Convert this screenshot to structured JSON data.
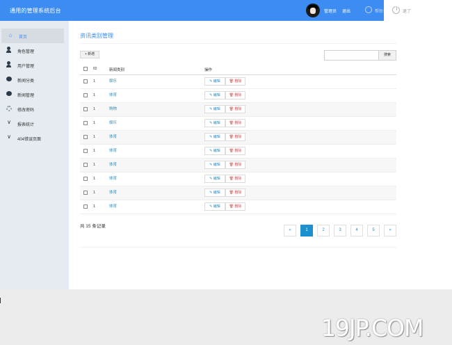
{
  "header": {
    "app_title": "通用的管理系统后台",
    "user_name": "管理员",
    "logout": "退出",
    "help_label": "帮助",
    "exit_label": "退了"
  },
  "sidebar": {
    "items": [
      {
        "label": "首页",
        "icon": "home-icon"
      },
      {
        "label": "角色管理",
        "icon": "user-icon"
      },
      {
        "label": "用户管理",
        "icon": "user-icon"
      },
      {
        "label": "新闻分类",
        "icon": "chat-icon"
      },
      {
        "label": "新闻管理",
        "icon": "chat-icon"
      },
      {
        "label": "修改密码",
        "icon": "gear-icon"
      },
      {
        "label": "报表统计",
        "icon": "chevron-down-icon"
      },
      {
        "label": "404错误页面",
        "icon": "chevron-down-icon"
      }
    ]
  },
  "main": {
    "title": "资讯类别管理",
    "add_button": "+ 新增",
    "search_placeholder": "",
    "search_button": "搜索"
  },
  "table": {
    "headers": {
      "id": "ID",
      "category": "新闻类别",
      "actions": "操作"
    },
    "edit_label": "✎ 编辑",
    "delete_label": "🗑 删除",
    "rows": [
      {
        "id": "1",
        "category": "娱乐"
      },
      {
        "id": "1",
        "category": "体育"
      },
      {
        "id": "1",
        "category": "购物"
      },
      {
        "id": "1",
        "category": "娱乐"
      },
      {
        "id": "1",
        "category": "体育"
      },
      {
        "id": "1",
        "category": "体育"
      },
      {
        "id": "1",
        "category": "体育"
      },
      {
        "id": "1",
        "category": "体育"
      },
      {
        "id": "1",
        "category": "体育"
      },
      {
        "id": "1",
        "category": "体育"
      }
    ]
  },
  "pagination": {
    "total_text": "共 15 条记录",
    "prev": "«",
    "pages": [
      "1",
      "2",
      "3",
      "4",
      "5"
    ],
    "next": "»",
    "current": "1"
  },
  "watermark": "19JP.COM",
  "colors": {
    "accent": "#3d8cf2",
    "link": "#2d8cbf",
    "danger": "#d44a4a",
    "sidebar_bg": "#e6ebf1"
  }
}
